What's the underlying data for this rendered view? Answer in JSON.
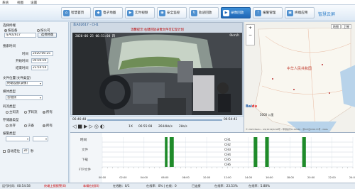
{
  "menu": [
    "系统",
    "视图",
    "设置"
  ],
  "nav": [
    {
      "label": "智慧首页",
      "icon": "home-icon"
    },
    {
      "label": "电子地图",
      "icon": "map-icon"
    },
    {
      "label": "实时视频",
      "icon": "camera-icon"
    },
    {
      "label": "安全监控",
      "icon": "shield-icon"
    },
    {
      "label": "轨迹回放",
      "icon": "route-icon"
    },
    {
      "label": "录像回放",
      "icon": "playback-icon",
      "active": true
    },
    {
      "label": "报警管理",
      "icon": "alarm-icon"
    },
    {
      "label": "终端应用",
      "icon": "terminal-icon"
    }
  ],
  "cloud_logo": "智慧云屏",
  "left": {
    "section_select": "选择终端",
    "radio_terminal": "按设备",
    "radio_group": "按公司",
    "terminal_value": "车A02617",
    "select_button": "选择终端",
    "section_time": "搜索时间",
    "date_label": "时间",
    "date_value": "2020-06-25",
    "start_label": "开始时间",
    "start_value": "00:00:00",
    "end_label": "结束时间",
    "end_value": "23:59:59",
    "location_label": "文件位置(文件类型)",
    "location_value": "终端设备(录像)",
    "media_label": "媒体类型",
    "media_value": "音视频",
    "stream_label": "码流类型",
    "stream_opts": [
      "主码流",
      "子码流",
      "所有"
    ],
    "storage_label": "存储器类型",
    "storage_opts": [
      "主存",
      "灾备",
      "所有"
    ],
    "alarm_label": "报警类型",
    "auto_label": "自动定位",
    "auto_value": "30",
    "auto_unit": "秒"
  },
  "video": {
    "title": "车A02617 - CH1",
    "notice": "温馨提示:右键回放录像文件可实现计划",
    "osd_time": "2020-06-25  06:51:04 四",
    "osd_speed": "0km/h",
    "time_start": "06:46:48",
    "time_end": "06:54:41",
    "speed": "1X",
    "current": "06:55:08",
    "rate": "2644kb/s",
    "volume": "2kb/s"
  },
  "map": {
    "label_country": "中华人民共和国",
    "label_zoom": "5000 公里",
    "label_copy": "© 2020 Baidu - GS(2019)5218号 - 甲测资字1100930 - 京ICP证030173号 - Data",
    "tab_map": "地图",
    "tab_sat": "卫星"
  },
  "timeline": {
    "col_header": "时间",
    "rows": [
      "文件",
      "下载",
      "FTP文件",
      "",
      "",
      ""
    ],
    "channels": [
      "CH1",
      "CH2",
      "CH3",
      "CH4",
      "CH5",
      "CH6"
    ],
    "hours": [
      "00:00",
      "02:00",
      "04:00",
      "06:00",
      "08:00",
      "10:00",
      "12:00",
      "14:00",
      "16:00",
      "18:00",
      "20:00",
      "22:00",
      "24:00"
    ]
  },
  "status": {
    "a": "运行时间：00:54:58",
    "b": "终端上报报警(0)",
    "c": "车辆在线(0)",
    "d": "在线数：0/1",
    "e": "在线率：0% | 在线：0",
    "f": "已连接",
    "g": "在线率：23.53%",
    "h": "在线率：5.88%"
  }
}
